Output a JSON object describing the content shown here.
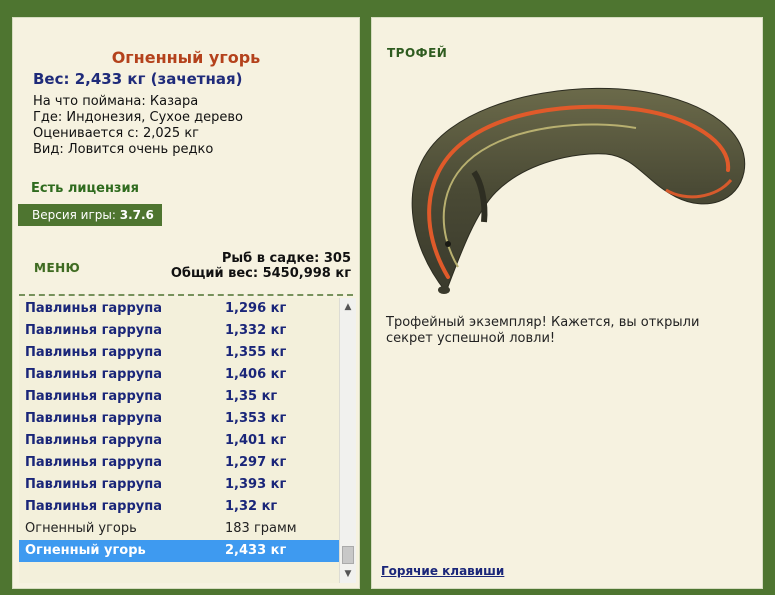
{
  "fish": {
    "name": "Огненный угорь",
    "weight_line": "Вес: 2,433 кг (зачетная)",
    "caught_with": "На что поймана: Казара",
    "location": "Где: Индонезия, Сухое дерево",
    "valued_from": "Оценивается с: 2,025 кг",
    "rarity": "Вид: Ловится очень редко"
  },
  "license": "Есть лицензия",
  "version": {
    "label": "Версия игры: ",
    "value": "3.7.6"
  },
  "menu_label": "МЕНЮ",
  "stats": {
    "fish_in_keepnet": "Рыб в садке: 305",
    "total_weight": "Общий вес: 5450,998 кг"
  },
  "catch_list": [
    {
      "name": "Павлинья гаррупа",
      "weight": "1,296 кг",
      "style": "bold"
    },
    {
      "name": "Павлинья гаррупа",
      "weight": "1,332 кг",
      "style": "bold"
    },
    {
      "name": "Павлинья гаррупа",
      "weight": "1,355 кг",
      "style": "bold"
    },
    {
      "name": "Павлинья гаррупа",
      "weight": "1,406 кг",
      "style": "bold"
    },
    {
      "name": "Павлинья гаррупа",
      "weight": "1,35 кг",
      "style": "bold"
    },
    {
      "name": "Павлинья гаррупа",
      "weight": "1,353 кг",
      "style": "bold"
    },
    {
      "name": "Павлинья гаррупа",
      "weight": "1,401 кг",
      "style": "bold"
    },
    {
      "name": "Павлинья гаррупа",
      "weight": "1,297 кг",
      "style": "bold"
    },
    {
      "name": "Павлинья гаррупа",
      "weight": "1,393 кг",
      "style": "bold"
    },
    {
      "name": "Павлинья гаррупа",
      "weight": "1,32 кг",
      "style": "bold"
    },
    {
      "name": "Огненный угорь",
      "weight": "183 грамм",
      "style": "plain"
    },
    {
      "name": "Огненный угорь",
      "weight": "2,433 кг",
      "style": "selected"
    }
  ],
  "trophy_label": "ТРОФЕЙ",
  "description": "Трофейный экземпляр! Кажется, вы открыли секрет успешной ловли!",
  "hotkeys_link": "Горячие клавиши",
  "colors": {
    "frame_green": "#4e7530",
    "panel_bg": "#f6f2e0",
    "title_orange": "#b4421c",
    "link_blue": "#1a2679",
    "selection_blue": "#3e9af0"
  },
  "icons": [
    "scroll-up-arrow-icon",
    "scroll-down-arrow-icon"
  ]
}
